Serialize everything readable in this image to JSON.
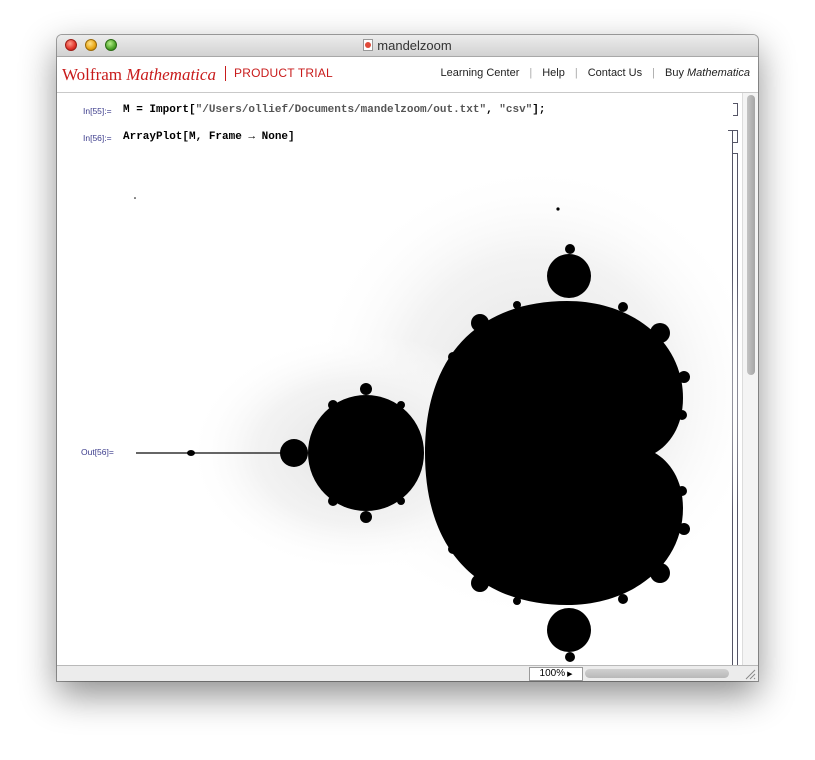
{
  "window": {
    "title": "mandelzoom"
  },
  "toolbar": {
    "brand_wolfram": "Wolfram",
    "brand_mathematica": "Mathematica",
    "trial_label": "PRODUCT TRIAL",
    "links": {
      "learning_center": "Learning Center",
      "help": "Help",
      "contact_us": "Contact Us",
      "buy_prefix": "Buy",
      "buy_product": "Mathematica"
    }
  },
  "notebook": {
    "cells": [
      {
        "label": "In[55]:=",
        "code_prefix": "M = Import[",
        "code_string1": "\"/Users/ollief/Documents/mandelzoom/out.txt\"",
        "code_comma": ", ",
        "code_string2": "\"csv\"",
        "code_suffix": "];"
      },
      {
        "label": "In[56]:=",
        "code_prefix": "ArrayPlot[M, Frame ",
        "code_arrow": "→",
        "code_suffix": " None]"
      }
    ],
    "output_label": "Out[56]="
  },
  "statusbar": {
    "zoom": "100%"
  },
  "colors": {
    "brand_red": "#c81b1b",
    "cell_label": "#3c3c8c",
    "fractal": "#000000"
  }
}
